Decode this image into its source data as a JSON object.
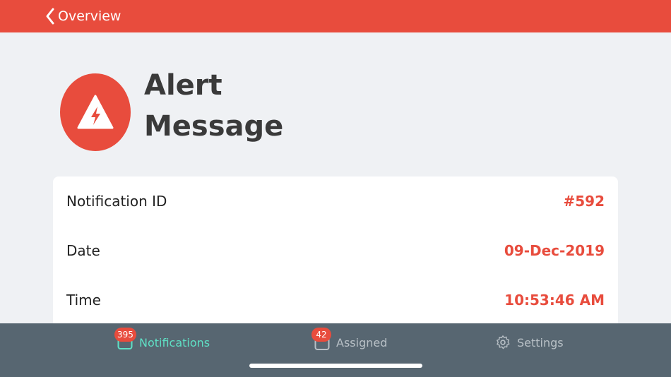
{
  "navbar": {
    "back_label": "Overview"
  },
  "alert": {
    "title_line1": "Alert",
    "title_line2": "Message"
  },
  "details": [
    {
      "label": "Notification ID",
      "value": "#592"
    },
    {
      "label": "Date",
      "value": "09-Dec-2019"
    },
    {
      "label": "Time",
      "value": "10:53:46 AM"
    }
  ],
  "tabs": {
    "notifications": {
      "label": "Notifications",
      "badge": "395"
    },
    "assigned": {
      "label": "Assigned",
      "badge": "42"
    },
    "settings": {
      "label": "Settings"
    }
  },
  "colors": {
    "accent": "#e84c3d",
    "active_tab": "#5fe0c5",
    "inactive_tab": "#b8c0c6",
    "tabbar_bg": "#576671"
  }
}
